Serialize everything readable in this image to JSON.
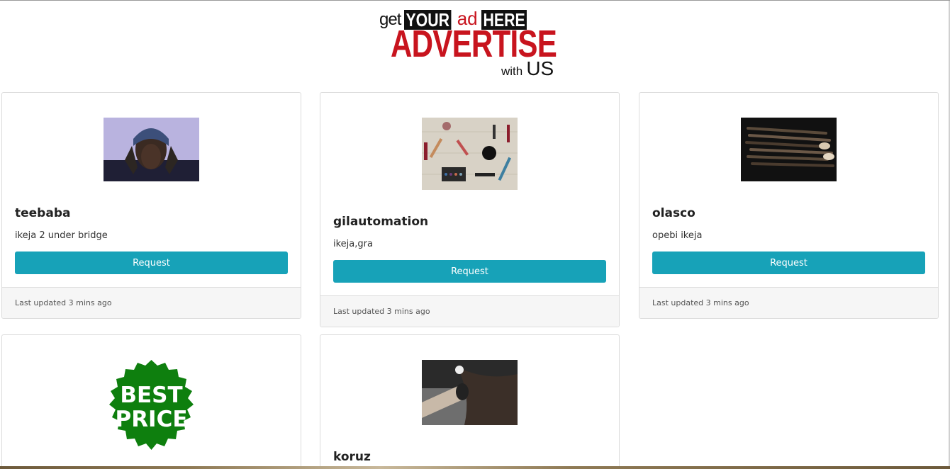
{
  "ad": {
    "get": "get",
    "your": "YOUR",
    "ad": "ad",
    "here": "HERE",
    "advertise": "ADVERTISE",
    "with": "with",
    "us": "US"
  },
  "cards": [
    {
      "title": "teebaba",
      "text": "ikeja 2 under bridge",
      "button": "Request",
      "footer": "Last updated 3 mins ago",
      "image": "woman-portrait"
    },
    {
      "title": "gilautomation",
      "text": "ikeja,gra",
      "button": "Request",
      "footer": "Last updated 3 mins ago",
      "image": "makeup-flatlay"
    },
    {
      "title": "olasco",
      "text": "opebi ikeja",
      "button": "Request",
      "footer": "Last updated 3 mins ago",
      "image": "makeup-brushes"
    },
    {
      "image": "best-price-badge",
      "badge_line1": "BEST",
      "badge_line2": "PRICE"
    },
    {
      "title": "koruz",
      "image": "hair-dryer"
    }
  ],
  "colors": {
    "button": "#17a2b8",
    "badge": "#0e7f0e",
    "ad_red": "#c8141e"
  }
}
